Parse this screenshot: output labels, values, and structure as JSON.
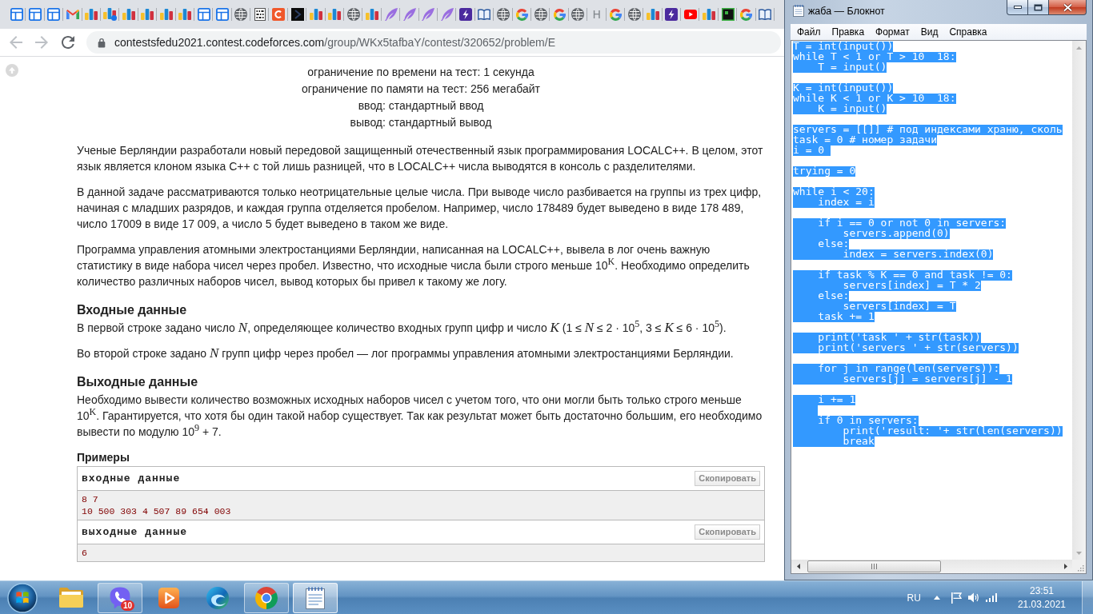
{
  "browser": {
    "tabs": [
      {
        "kind": "window"
      },
      {
        "kind": "window"
      },
      {
        "kind": "window"
      },
      {
        "kind": "mail"
      },
      {
        "kind": "bars"
      },
      {
        "kind": "bars-dot"
      },
      {
        "kind": "bars"
      },
      {
        "kind": "bars"
      },
      {
        "kind": "bars"
      },
      {
        "kind": "bars"
      },
      {
        "kind": "window"
      },
      {
        "kind": "window"
      },
      {
        "kind": "globe"
      },
      {
        "kind": "binary"
      },
      {
        "kind": "orange"
      },
      {
        "kind": "dark"
      },
      {
        "kind": "bars"
      },
      {
        "kind": "bars"
      },
      {
        "kind": "globe"
      },
      {
        "kind": "bars"
      },
      {
        "kind": "feather"
      },
      {
        "kind": "feather"
      },
      {
        "kind": "feather"
      },
      {
        "kind": "feather"
      },
      {
        "kind": "bolt"
      },
      {
        "kind": "book"
      },
      {
        "kind": "globe"
      },
      {
        "kind": "google"
      },
      {
        "kind": "globe"
      },
      {
        "kind": "google"
      },
      {
        "kind": "globe"
      },
      {
        "kind": "letter",
        "label": "H"
      },
      {
        "kind": "google"
      },
      {
        "kind": "globe"
      },
      {
        "kind": "bars"
      },
      {
        "kind": "bolt"
      },
      {
        "kind": "youtube"
      },
      {
        "kind": "bars"
      },
      {
        "kind": "frame"
      },
      {
        "kind": "google"
      },
      {
        "kind": "book"
      }
    ],
    "back": {
      "disabled": true
    },
    "forward": {
      "disabled": true
    },
    "address": {
      "host": "contestsfedu2021.contest.codeforces.com",
      "path": "/group/WKx5tafbaY/contest/320652/problem/E"
    },
    "page": {
      "limits": [
        "ограничение по времени на тест: 1 секунда",
        "ограничение по памяти на тест: 256 мегабайт",
        "ввод: стандартный ввод",
        "вывод: стандартный вывод"
      ],
      "legend": [
        "Ученые Берляндии разработали новый передовой защищенный отечественный язык программирования LOCALC++. В целом, этот язык является клоном языка C++ с той лишь разницей, что в LOCALC++ числа выводятся в консоль с разделителями.",
        "В данной задаче рассматриваются только неотрицательные целые числа. При выводе число разбивается на группы из трех цифр, начиная с младших разрядов, и каждая группа отделяется пробелом. Например, число 178489 будет выведено в виде 178 489, число 17009 в виде 17 009, а число 5 будет выведено в таком же виде.",
        "Программа управления атомными электростанциями Берляндии, написанная на LOCALC++, вывела в лог очень важную статистику в виде набора чисел через пробел. Известно, что исходные числа были строго меньше 10$^{K}$. Необходимо определить количество различных наборов чисел, вывод которых бы привел к такому же логу."
      ],
      "sections": [
        {
          "title": "Входные данные",
          "paragraphs": [
            "В первой строке задано число *N*, определяющее количество входных групп цифр и число *K* (1 ≤ *N* ≤ 2 · 10$^{5}$, 3 ≤ *K* ≤ 6 · 10$^{5}$).",
            "Во второй строке задано *N* групп цифр через пробел — лог программы управления атомными электростанциями Берляндии."
          ]
        },
        {
          "title": "Выходные данные",
          "paragraphs": [
            "Необходимо вывести количество возможных исходных наборов чисел с учетом того, что они могли быть только строго меньше 10$^{K}$. Гарантируется, что хотя бы один такой набор существует. Так как результат может быть достаточно большим, его необходимо вывести по модулю 10$^{9}$ + 7."
          ]
        }
      ],
      "examples": {
        "title": "Примеры",
        "blocks": [
          {
            "title": "входные данные",
            "copy": "Скопировать",
            "lines": [
              "8 7",
              "10 500 303 4 507 89 654 003"
            ]
          },
          {
            "title": "выходные данные",
            "copy": "Скопировать",
            "lines": [
              "6"
            ]
          }
        ]
      }
    }
  },
  "notepad": {
    "title": "жаба — Блокнот",
    "menu": [
      "Файл",
      "Правка",
      "Формат",
      "Вид",
      "Справка"
    ],
    "editor": {
      "selected": true,
      "text": "T = int(input())\nwhile T < 1 or T > 10  18:\n    T = input()\n\nK = int(input())\nwhile K < 1 or K > 10  18:\n    K = input()\n\nservers = [[]] # под индексами храню, сколь\ntask = 0 # номер задачи\ni = 0 \n\ntrying = 0\n\nwhile i < 20:\n    index = i\n\n    if i == 0 or not 0 in servers:\n        servers.append(0)\n    else:\n        index = servers.index(0)\n\n    if task % K == 0 and task != 0:\n        servers[index] = T * 2\n    else:\n        servers[index] = T\n    task += 1\n\n    print('task ' + str(task))\n    print('servers ' + str(servers))\n\n    for j in range(len(servers)):\n        servers[j] = servers[j] - 1\n\n    i += 1\n    \n    if 0 in servers:\n        print('result: '+ str(len(servers))\n        break"
    }
  },
  "taskbar": {
    "items": [
      {
        "kind": "folder",
        "running": false,
        "selected": false
      },
      {
        "kind": "viber",
        "running": true,
        "selected": false,
        "badge": "10"
      },
      {
        "kind": "media",
        "running": false,
        "selected": false
      },
      {
        "kind": "edge",
        "running": false,
        "selected": false
      },
      {
        "kind": "chrome",
        "running": true,
        "selected": false
      },
      {
        "kind": "notepad",
        "running": true,
        "selected": true
      }
    ],
    "tray": {
      "language": "RU",
      "time": "23:51",
      "date": "21.03.2021"
    }
  }
}
